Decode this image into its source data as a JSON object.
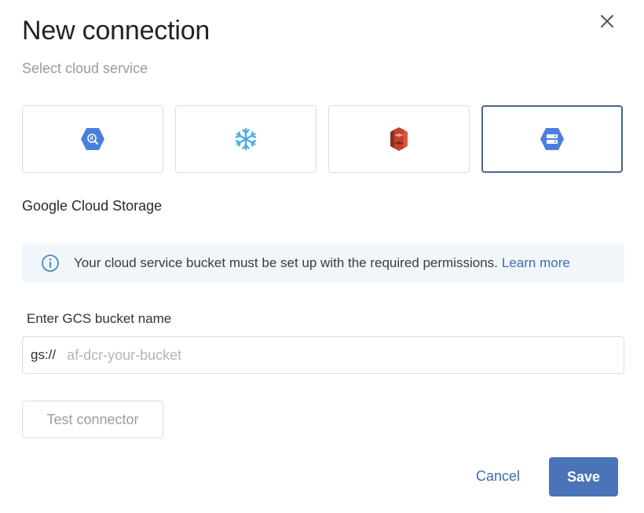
{
  "dialog": {
    "title": "New connection",
    "subtitle": "Select cloud service",
    "close_icon": "close-icon"
  },
  "services": [
    {
      "name": "bigquery",
      "icon": "bigquery-icon",
      "color": "#4a7fe0",
      "selected": false
    },
    {
      "name": "snowflake",
      "icon": "snowflake-icon",
      "color": "#4aaee6",
      "selected": false
    },
    {
      "name": "amazon-s3",
      "icon": "amazon-s3-icon",
      "color": "#c0432f",
      "selected": false
    },
    {
      "name": "google-cloud-storage",
      "icon": "gcs-icon",
      "color": "#4a7fe0",
      "selected": true
    }
  ],
  "selected_service_label": "Google Cloud Storage",
  "banner": {
    "icon": "info-icon",
    "text": "Your cloud service bucket must be set up with the required permissions.",
    "link_text": "Learn more"
  },
  "bucket": {
    "label": "Enter GCS bucket name",
    "prefix": "gs://",
    "value": "",
    "placeholder": "af-dcr-your-bucket"
  },
  "buttons": {
    "test": "Test connector",
    "cancel": "Cancel",
    "save": "Save"
  },
  "colors": {
    "accent": "#4a73b8",
    "link": "#3f6bb0",
    "selected_border": "#4a6691",
    "banner_bg": "#f1f6fa"
  }
}
